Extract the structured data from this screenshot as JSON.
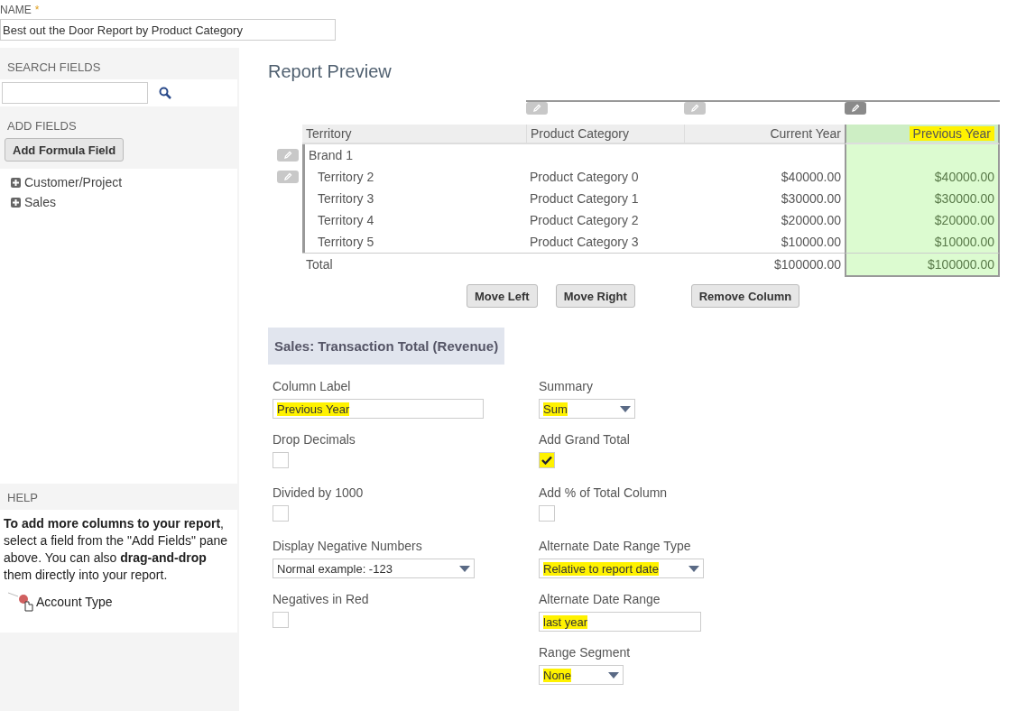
{
  "name_field": {
    "label": "NAME",
    "required_mark": "*",
    "value": "Best out the Door Report by Product Category"
  },
  "sidebar": {
    "search_heading": "SEARCH FIELDS",
    "add_heading": "ADD FIELDS",
    "add_button": "Add Formula Field",
    "tree": [
      {
        "label": "Customer/Project",
        "expanded": false
      },
      {
        "label": "Sales",
        "expanded": false
      }
    ],
    "help_heading": "HELP",
    "help_text": "**To add more columns to your report**, select a field from the \"Add Fields\" pane above. You can also **drag-and-drop** them directly into your report.",
    "drag_example": "Account Type"
  },
  "preview": {
    "title": "Report Preview",
    "columns": [
      {
        "label": "Territory",
        "kind": "text",
        "selected": false,
        "highlighted": false
      },
      {
        "label": "Product Category",
        "kind": "text",
        "selected": false,
        "highlighted": false
      },
      {
        "label": "Current Year",
        "kind": "amount",
        "selected": false,
        "highlighted": false
      },
      {
        "label": "Previous Year",
        "kind": "amount",
        "selected": true,
        "highlighted": true
      }
    ],
    "rows": [
      {
        "kind": "group",
        "cells": [
          "Brand 1"
        ]
      },
      {
        "kind": "item",
        "cells": [
          "Territory 2",
          "Product Category 0",
          "$40000.00",
          "$40000.00"
        ]
      },
      {
        "kind": "item",
        "cells": [
          "Territory 3",
          "Product Category 1",
          "$30000.00",
          "$30000.00"
        ]
      },
      {
        "kind": "item",
        "cells": [
          "Territory 4",
          "Product Category 2",
          "$20000.00",
          "$20000.00"
        ]
      },
      {
        "kind": "item",
        "cells": [
          "Territory 5",
          "Product Category 3",
          "$10000.00",
          "$10000.00"
        ]
      }
    ],
    "total": {
      "label": "Total",
      "amounts": [
        "$100000.00",
        "$100000.00"
      ]
    },
    "buttons": [
      "Move Left",
      "Move Right",
      "Remove Column"
    ]
  },
  "column_settings": {
    "title": "Sales: Transaction Total (Revenue)",
    "left": [
      {
        "kind": "text",
        "label": "Column Label",
        "value": "Previous Year",
        "highlighted": true
      },
      {
        "kind": "checkbox",
        "label": "Drop Decimals",
        "checked": false,
        "highlighted": false
      },
      {
        "kind": "checkbox",
        "label": "Divided by 1000",
        "checked": false,
        "highlighted": false
      },
      {
        "kind": "select",
        "label": "Display Negative Numbers",
        "value": "Normal  example: -123",
        "highlighted": false
      },
      {
        "kind": "checkbox",
        "label": "Negatives in Red",
        "checked": false,
        "highlighted": false
      }
    ],
    "right": [
      {
        "kind": "select",
        "label": "Summary",
        "value": "Sum",
        "highlighted": true
      },
      {
        "kind": "checkbox",
        "label": "Add Grand Total",
        "checked": true,
        "highlighted": true
      },
      {
        "kind": "checkbox",
        "label": "Add % of Total Column",
        "checked": false,
        "highlighted": false
      },
      {
        "kind": "select",
        "label": "Alternate Date Range Type",
        "value": "Relative to report date",
        "highlighted": true
      },
      {
        "kind": "text",
        "label": "Alternate Date Range",
        "value": "last year",
        "highlighted": true
      },
      {
        "kind": "select",
        "label": "Range Segment",
        "value": "None",
        "highlighted": true
      }
    ]
  }
}
